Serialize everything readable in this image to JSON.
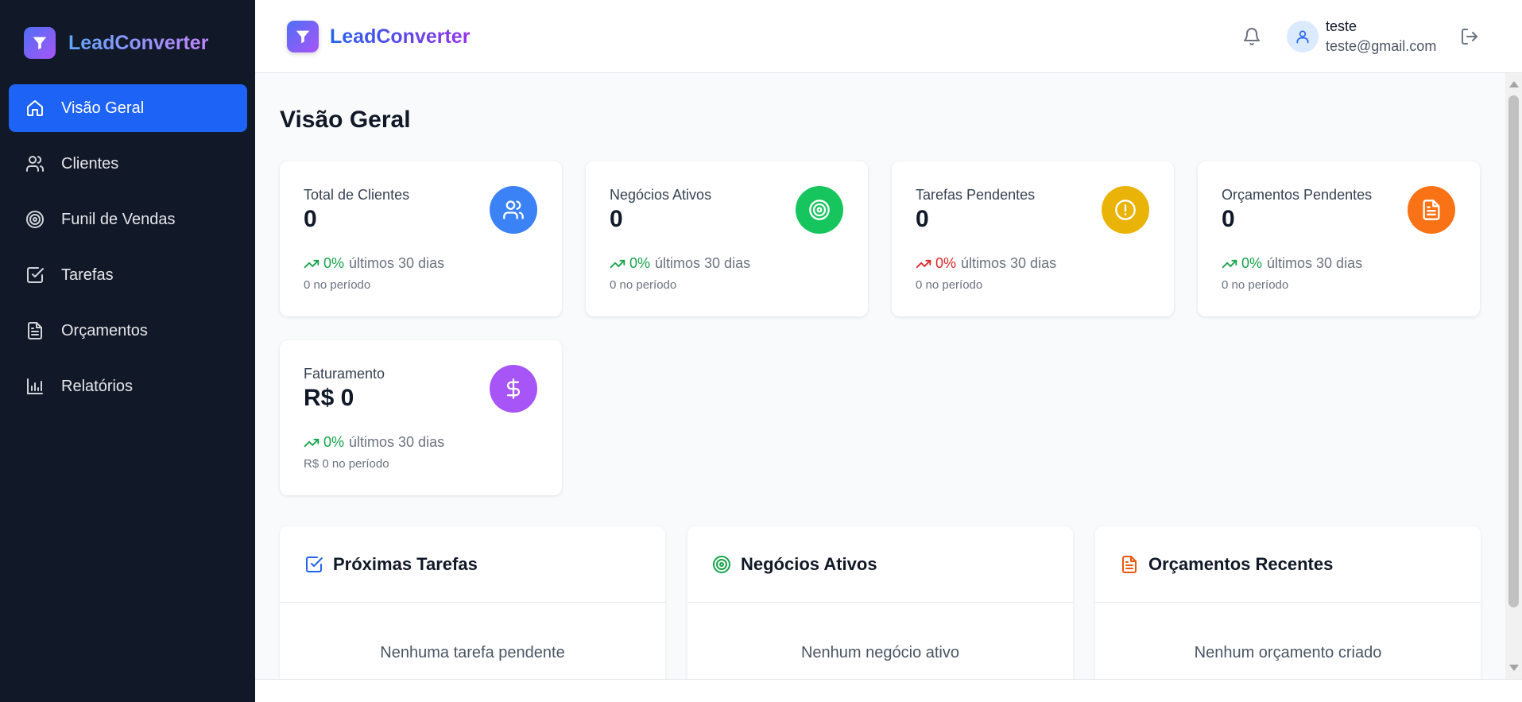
{
  "brand": {
    "name": "LeadConverter",
    "logo_icon": "filter-icon"
  },
  "sidebar": {
    "items": [
      {
        "label": "Visão Geral",
        "icon": "home-icon",
        "active": true
      },
      {
        "label": "Clientes",
        "icon": "users-icon"
      },
      {
        "label": "Funil de Vendas",
        "icon": "target-icon"
      },
      {
        "label": "Tarefas",
        "icon": "check-square-icon"
      },
      {
        "label": "Orçamentos",
        "icon": "file-text-icon"
      },
      {
        "label": "Relatórios",
        "icon": "bar-chart-icon"
      }
    ]
  },
  "header": {
    "user_name": "teste",
    "user_email": "teste@gmail.com",
    "icons": [
      "bell-icon",
      "user-icon",
      "logout-icon"
    ]
  },
  "main": {
    "title": "Visão Geral",
    "stats": [
      {
        "label": "Total de Clientes",
        "value": "0",
        "pct": "0%",
        "trend_text": "últimos 30 dias",
        "sub": "0 no período",
        "color": "#3b82f6",
        "trend_color": "#16a34a",
        "icon": "users-icon"
      },
      {
        "label": "Negócios Ativos",
        "value": "0",
        "pct": "0%",
        "trend_text": "últimos 30 dias",
        "sub": "0 no período",
        "color": "#16c55e",
        "trend_color": "#16a34a",
        "icon": "target-icon"
      },
      {
        "label": "Tarefas Pendentes",
        "value": "0",
        "pct": "0%",
        "trend_text": "últimos 30 dias",
        "sub": "0 no período",
        "color": "#eab308",
        "trend_color": "#dc2626",
        "icon": "alert-circle-icon"
      },
      {
        "label": "Orçamentos Pendentes",
        "value": "0",
        "pct": "0%",
        "trend_text": "últimos 30 dias",
        "sub": "0 no período",
        "color": "#f97316",
        "trend_color": "#16a34a",
        "icon": "file-text-icon"
      },
      {
        "label": "Faturamento",
        "value": "R$ 0",
        "pct": "0%",
        "trend_text": "últimos 30 dias",
        "sub": "R$ 0 no período",
        "color": "#a855f7",
        "trend_color": "#16a34a",
        "icon": "dollar-icon"
      }
    ],
    "panels": [
      {
        "title": "Próximas Tarefas",
        "empty": "Nenhuma tarefa pendente",
        "icon": "check-square-icon",
        "color": "#2563eb"
      },
      {
        "title": "Negócios Ativos",
        "empty": "Nenhum negócio ativo",
        "icon": "target-icon",
        "color": "#16a34a"
      },
      {
        "title": "Orçamentos Recentes",
        "empty": "Nenhum orçamento criado",
        "icon": "file-text-icon",
        "color": "#ea580c"
      }
    ]
  }
}
